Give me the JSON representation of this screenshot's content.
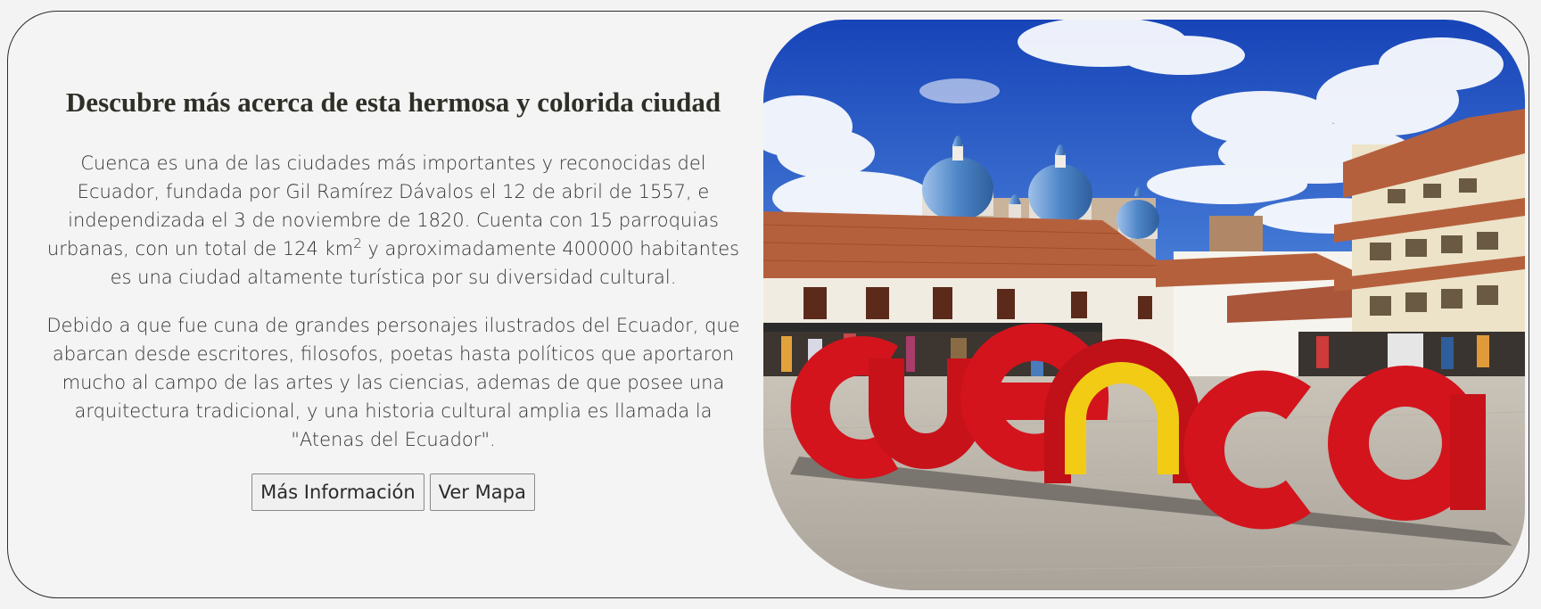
{
  "section": {
    "heading": "Descubre más acerca de esta hermosa y colorida ciudad",
    "paragraph1_part1": "Cuenca es una de las ciudades más importantes y reconocidas del Ecuador, fundada por Gil Ramírez Dávalos el 12 de abril de 1557, e independizada el 3 de noviembre de 1820. Cuenta con 15 parroquias urbanas, con un total de 124 km",
    "paragraph1_sup": "2",
    "paragraph1_part2": " y aproximadamente 400000 habitantes es una ciudad altamente turística por su diversidad cultural.",
    "paragraph2": "Debido a que fue cuna de grandes personajes ilustrados del Ecuador, que abarcan desde escritores, filosofos, poetas hasta políticos que aportaron mucho al campo de las artes y las ciencias, ademas de que posee una arquitectura tradicional, y una historia cultural amplia es llamada la \"Atenas del Ecuador\".",
    "buttons": {
      "more_info": "Más Información",
      "view_map": "Ver Mapa"
    }
  },
  "photo": {
    "sign_text": "cuenca",
    "colors": {
      "sky": "#1f56c7",
      "sign_red": "#d3141d",
      "sign_yellow": "#f2cc14",
      "roof": "#b5603c",
      "dome": "#4e86c8"
    }
  }
}
